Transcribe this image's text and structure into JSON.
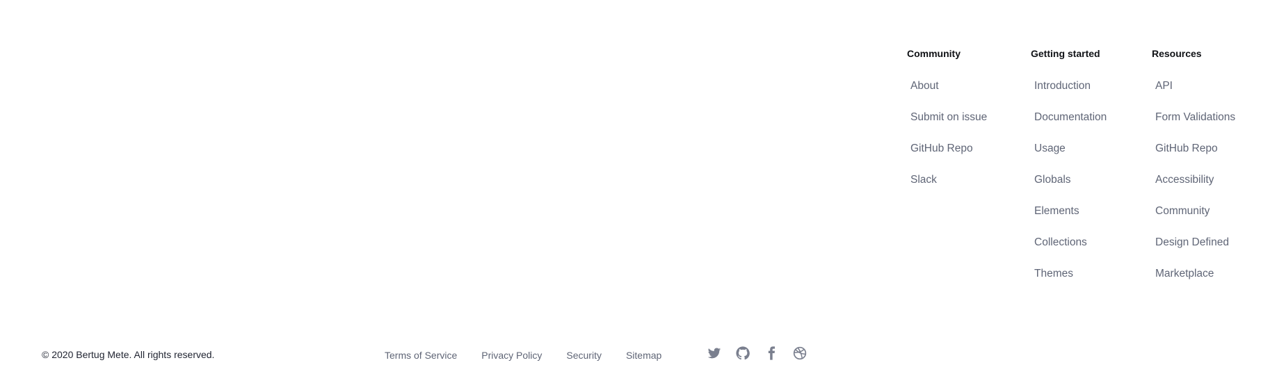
{
  "columns": {
    "community": {
      "heading": "Community",
      "links": [
        "About",
        "Submit on issue",
        "GitHub Repo",
        "Slack"
      ]
    },
    "getting_started": {
      "heading": "Getting started",
      "links": [
        "Introduction",
        "Documentation",
        "Usage",
        "Globals",
        "Elements",
        "Collections",
        "Themes"
      ]
    },
    "resources": {
      "heading": "Resources",
      "links": [
        "API",
        "Form Validations",
        "GitHub Repo",
        "Accessibility",
        "Community",
        "Design Defined",
        "Marketplace"
      ]
    }
  },
  "bottom": {
    "copyright": "© 2020 Bertug Mete. All rights reserved.",
    "legal_links": [
      "Terms of Service",
      "Privacy Policy",
      "Security",
      "Sitemap"
    ]
  },
  "social_icons": [
    "twitter-icon",
    "github-icon",
    "facebook-icon",
    "dribbble-icon"
  ],
  "colors": {
    "heading": "#0f1115",
    "link": "#5f6576",
    "icon": "#7a7f8e"
  }
}
